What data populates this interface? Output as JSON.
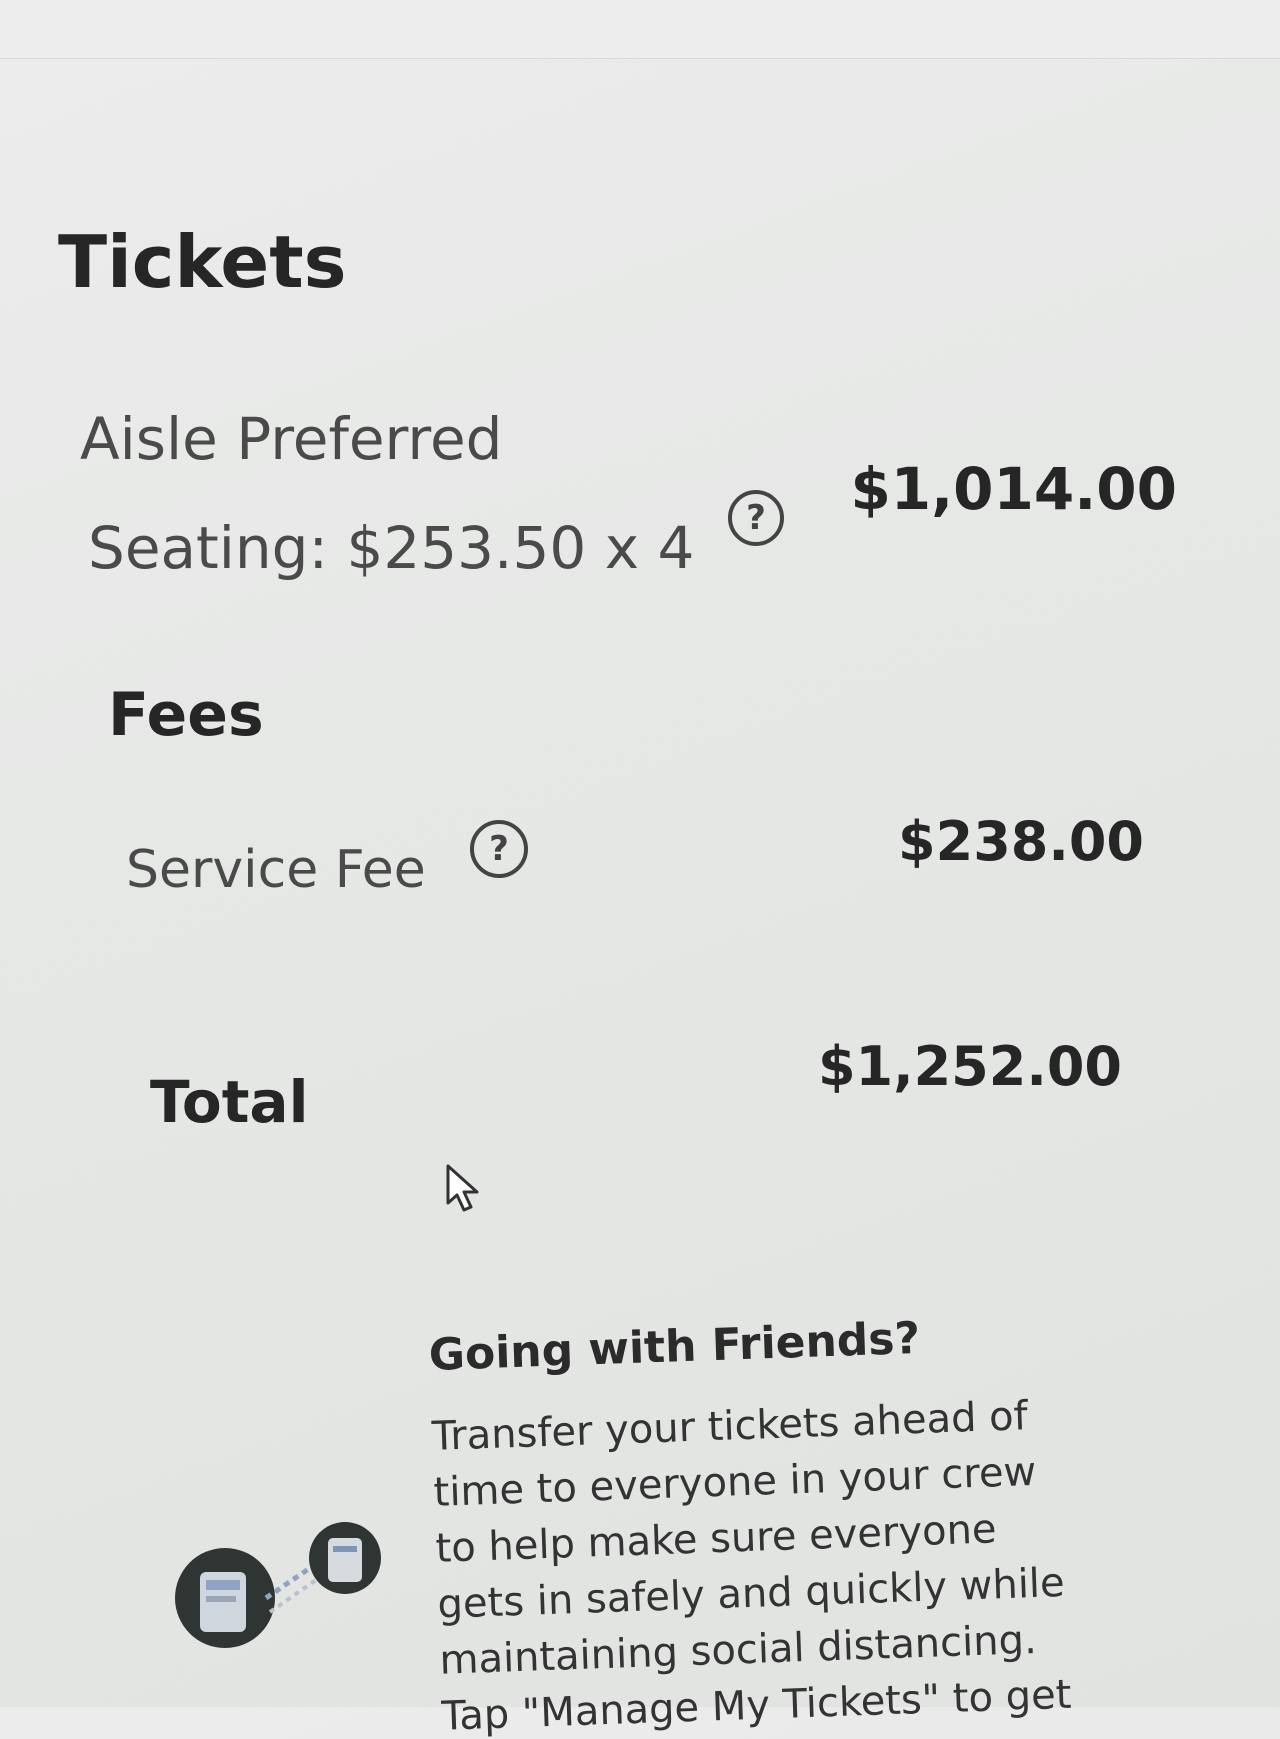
{
  "tickets": {
    "title": "Tickets",
    "item_name": "Aisle Preferred",
    "item_seating": "Seating: $253.50 x 4",
    "item_amount": "$1,014.00",
    "help_icon_glyph": "?"
  },
  "fees": {
    "title": "Fees",
    "service_fee_label": "Service Fee",
    "service_fee_amount": "$238.00",
    "help_icon_glyph": "?"
  },
  "total": {
    "label": "Total",
    "amount": "$1,252.00"
  },
  "promo": {
    "title": "Going with Friends?",
    "body": "Transfer your tickets ahead of\ntime to everyone in your crew\nto help make sure everyone\ngets in safely and quickly while\nmaintaining social distancing.\nTap \"Manage My Tickets\" to get",
    "illustration_icon": "phone-transfer-icon"
  },
  "icons": {
    "help": "question-circle-icon",
    "cursor": "mouse-pointer-icon"
  }
}
